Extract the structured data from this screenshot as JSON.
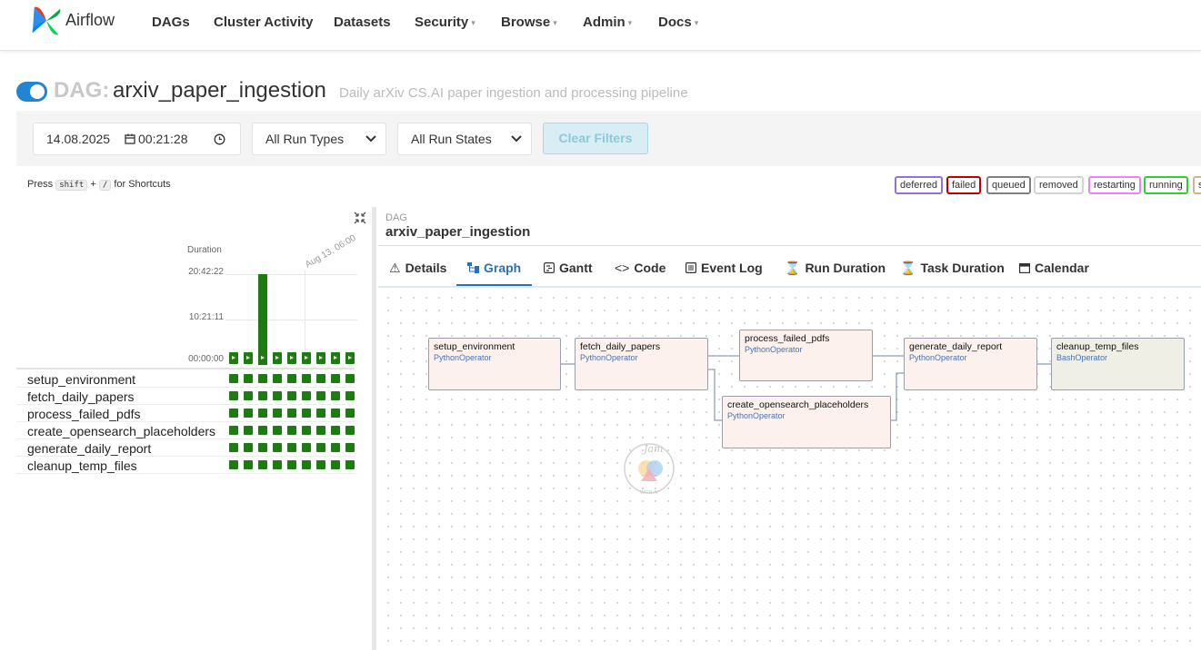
{
  "brand": {
    "name": "Airflow"
  },
  "nav": [
    {
      "label": "DAGs",
      "dropdown": false
    },
    {
      "label": "Cluster Activity",
      "dropdown": false
    },
    {
      "label": "Datasets",
      "dropdown": false
    },
    {
      "label": "Security",
      "dropdown": true
    },
    {
      "label": "Browse",
      "dropdown": true
    },
    {
      "label": "Admin",
      "dropdown": true
    },
    {
      "label": "Docs",
      "dropdown": true
    }
  ],
  "dag": {
    "prefix": "DAG:",
    "id": "arxiv_paper_ingestion",
    "description": "Daily arXiv CS.AI paper ingestion and processing pipeline",
    "paused": false
  },
  "filters": {
    "date": "14.08.2025",
    "time": "00:21:28",
    "run_type": "All Run Types",
    "run_state": "All Run States",
    "clear_label": "Clear Filters"
  },
  "shortcuts": {
    "press": "Press",
    "key1": "shift",
    "plus": "+",
    "key2": "/",
    "suffix": "for Shortcuts"
  },
  "legend": [
    {
      "label": "deferred",
      "color": "#9370db"
    },
    {
      "label": "failed",
      "color": "#c00000"
    },
    {
      "label": "queued",
      "color": "#808080"
    },
    {
      "label": "removed",
      "color": "#d3d3d3"
    },
    {
      "label": "restarting",
      "color": "#ee82ee"
    },
    {
      "label": "running",
      "color": "#32cd32"
    },
    {
      "label": "s",
      "color": "#d2b48c"
    }
  ],
  "grid": {
    "duration_label": "Duration",
    "ticks": [
      "20:42:22",
      "10:21:11",
      "00:00:00"
    ],
    "date_label": "Aug 13, 06:00",
    "run_count": 9,
    "highlighted_run": 3,
    "success_color": "#1e7b12",
    "tasks": [
      "setup_environment",
      "fetch_daily_papers",
      "process_failed_pdfs",
      "create_opensearch_placeholders",
      "generate_daily_report",
      "cleanup_temp_files"
    ]
  },
  "panel": {
    "crumb_small": "DAG",
    "crumb_big": "arxiv_paper_ingestion",
    "tabs": [
      {
        "label": "Details",
        "icon": "warning-triangle-icon",
        "active": false
      },
      {
        "label": "Graph",
        "icon": "graph-icon",
        "active": true
      },
      {
        "label": "Gantt",
        "icon": "gantt-icon",
        "active": false
      },
      {
        "label": "Code",
        "icon": "code-icon",
        "active": false
      },
      {
        "label": "Event Log",
        "icon": "event-log-icon",
        "active": false
      },
      {
        "label": "Run Duration",
        "icon": "hourglass-icon",
        "active": false
      },
      {
        "label": "Task Duration",
        "icon": "hourglass-icon",
        "active": false
      },
      {
        "label": "Calendar",
        "icon": "calendar-icon",
        "active": false
      }
    ]
  },
  "graph": {
    "nodes": [
      {
        "name": "setup_environment",
        "operator": "PythonOperator"
      },
      {
        "name": "fetch_daily_papers",
        "operator": "PythonOperator"
      },
      {
        "name": "process_failed_pdfs",
        "operator": "PythonOperator"
      },
      {
        "name": "create_opensearch_placeholders",
        "operator": "PythonOperator"
      },
      {
        "name": "generate_daily_report",
        "operator": "PythonOperator"
      },
      {
        "name": "cleanup_temp_files",
        "operator": "BashOperator"
      }
    ],
    "edges": [
      [
        "setup_environment",
        "fetch_daily_papers"
      ],
      [
        "fetch_daily_papers",
        "process_failed_pdfs"
      ],
      [
        "fetch_daily_papers",
        "create_opensearch_placeholders"
      ],
      [
        "process_failed_pdfs",
        "generate_daily_report"
      ],
      [
        "create_opensearch_placeholders",
        "generate_daily_report"
      ],
      [
        "generate_daily_report",
        "cleanup_temp_files"
      ]
    ],
    "watermark_text": "Jam with AI"
  }
}
